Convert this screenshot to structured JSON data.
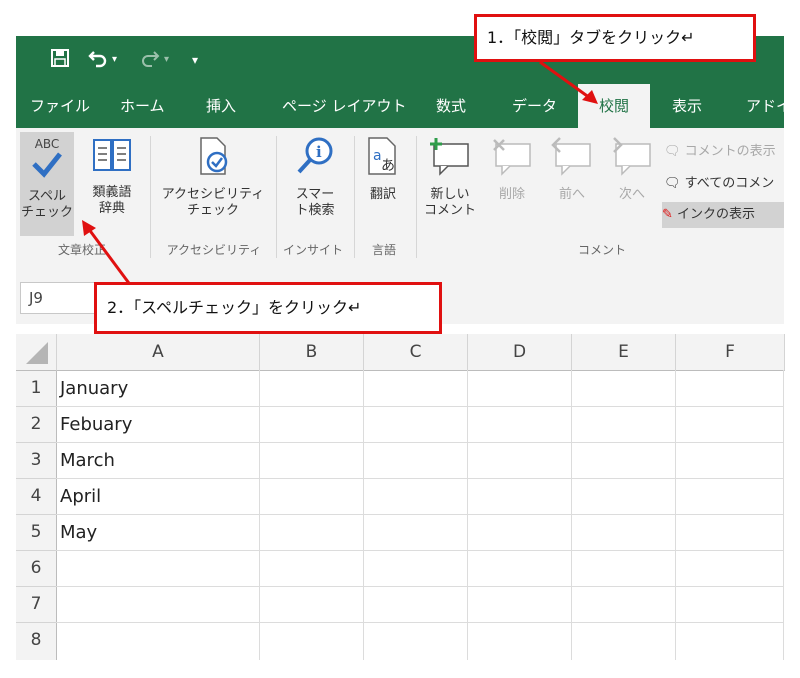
{
  "qat": {
    "save_icon": "save-icon",
    "undo_icon": "undo-icon",
    "redo_icon": "redo-icon",
    "customize_icon": "customize-icon"
  },
  "tabs": [
    {
      "label": "ファイル"
    },
    {
      "label": "ホーム"
    },
    {
      "label": "挿入"
    },
    {
      "label": "ページ レイアウト"
    },
    {
      "label": "数式"
    },
    {
      "label": "データ"
    },
    {
      "label": "校閲"
    },
    {
      "label": "表示"
    },
    {
      "label": "アドイ"
    }
  ],
  "ribbon": {
    "spell_check": "スペル\nチェック",
    "thesaurus": "類義語\n辞典",
    "accessibility": "アクセシビリティ\nチェック",
    "smart_lookup": "スマー\nト検索",
    "translate": "翻訳",
    "new_comment": "新しい\nコメント",
    "delete": "削除",
    "previous": "前へ",
    "next": "次へ",
    "show_comment": "コメントの表示",
    "show_all_comments": "すべてのコメン",
    "show_ink": "インクの表示",
    "groups": {
      "proofing": "文章校正",
      "accessibility": "アクセシビリティ",
      "insights": "インサイト",
      "language": "言語",
      "comments": "コメント"
    },
    "abc": "ABC"
  },
  "name_box": {
    "value": "J9"
  },
  "grid": {
    "columns": [
      "A",
      "B",
      "C",
      "D",
      "E",
      "F"
    ],
    "rows": [
      "1",
      "2",
      "3",
      "4",
      "5",
      "6",
      "7",
      "8"
    ],
    "values": [
      "January",
      "Febuary",
      "March",
      "April",
      "May"
    ]
  },
  "callouts": {
    "step1": "1．「校閲」タブをクリック↵",
    "step2": "2．「スペルチェック」をクリック↵"
  },
  "colors": {
    "excel_green": "#217346",
    "callout_red": "#e01010"
  }
}
